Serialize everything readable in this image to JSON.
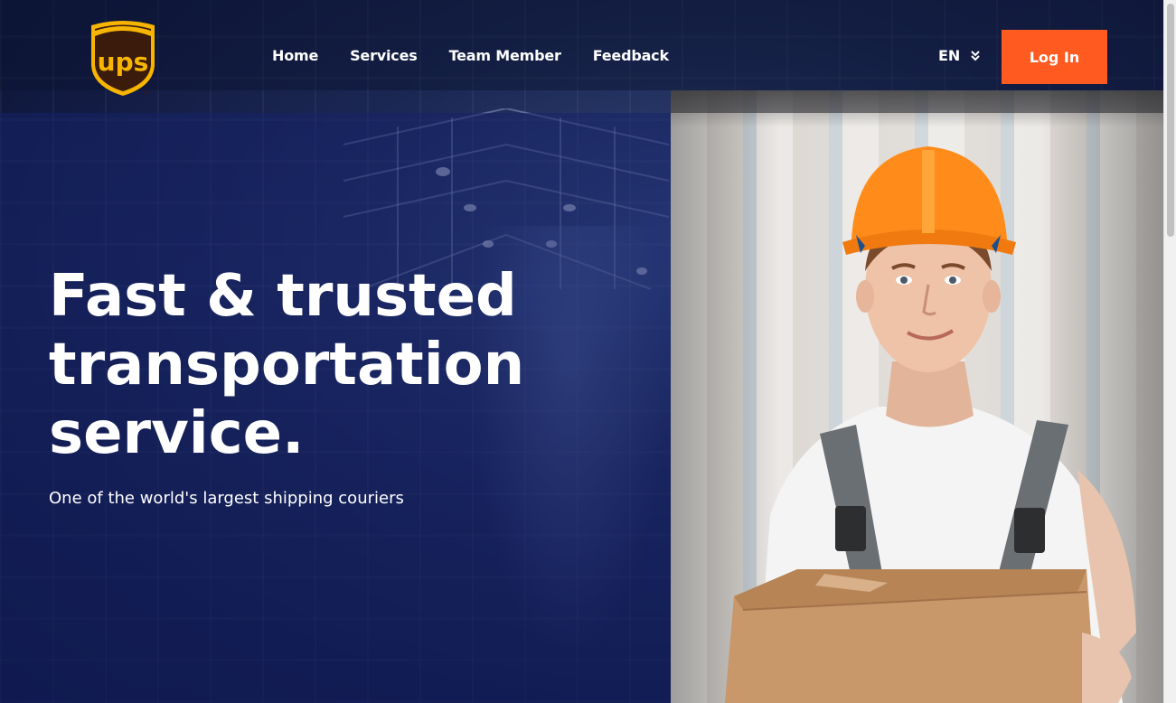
{
  "brand": {
    "logo_text": "ups",
    "logo_colors": {
      "shield": "#3b1c0c",
      "gold": "#f7b500"
    }
  },
  "nav": {
    "items": [
      {
        "label": "Home"
      },
      {
        "label": "Services"
      },
      {
        "label": "Team Member"
      },
      {
        "label": "Feedback"
      }
    ]
  },
  "language": {
    "selected": "EN",
    "icon": "double-chevron-down-icon"
  },
  "auth": {
    "login_label": "Log In",
    "login_color": "#ff5a1f"
  },
  "hero": {
    "title_lines": [
      "Fast & trusted",
      "transportation",
      "service."
    ],
    "subtitle": "One of the world's largest shipping couriers"
  },
  "colors": {
    "overlay_blue": "#162268",
    "accent_orange": "#ff5a1f"
  }
}
